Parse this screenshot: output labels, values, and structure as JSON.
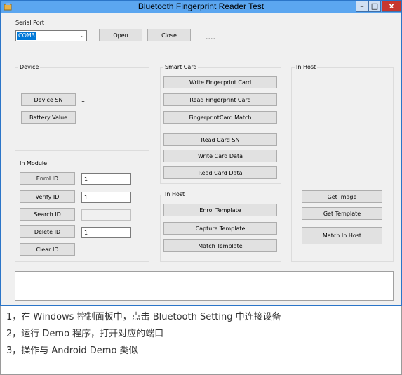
{
  "window": {
    "title": "Bluetooth Fingerprint Reader Test",
    "minimize": "–",
    "maximize": "□",
    "close": "x"
  },
  "serial": {
    "label": "Serial Port",
    "port_value": "COM3",
    "open_label": "Open",
    "close_label": "Close",
    "status": "...."
  },
  "device": {
    "group_title": "Device",
    "device_sn_label": "Device SN",
    "device_sn_value": "...",
    "battery_label": "Battery Value",
    "battery_value": "..."
  },
  "module": {
    "group_title": "In Module",
    "enrol_label": "Enrol ID",
    "enrol_value": "1",
    "verify_label": "Verify ID",
    "verify_value": "1",
    "search_label": "Search ID",
    "search_value": "",
    "delete_label": "Delete ID",
    "delete_value": "1",
    "clear_label": "Clear ID"
  },
  "smartcard": {
    "group_title": "Smart Card",
    "buttons": [
      "Write Fingerprint Card",
      "Read Fingerprint Card",
      "FingerprintCard Match",
      "Read Card SN",
      "Write Card Data",
      "Read Card Data"
    ]
  },
  "inhost_mid": {
    "group_title": "In Host",
    "buttons": [
      "Enrol Template",
      "Capture Template",
      "Match Template"
    ]
  },
  "inhost_right": {
    "group_title": "In Host",
    "buttons": [
      "Get Image",
      "Get Template",
      "Match In Host"
    ]
  },
  "output": "",
  "notes": [
    "1，在 Windows 控制面板中，点击 Bluetooth Setting 中连接设备",
    "2，运行 Demo 程序，打开对应的端口",
    "3，操作与 Android Demo 类似"
  ]
}
